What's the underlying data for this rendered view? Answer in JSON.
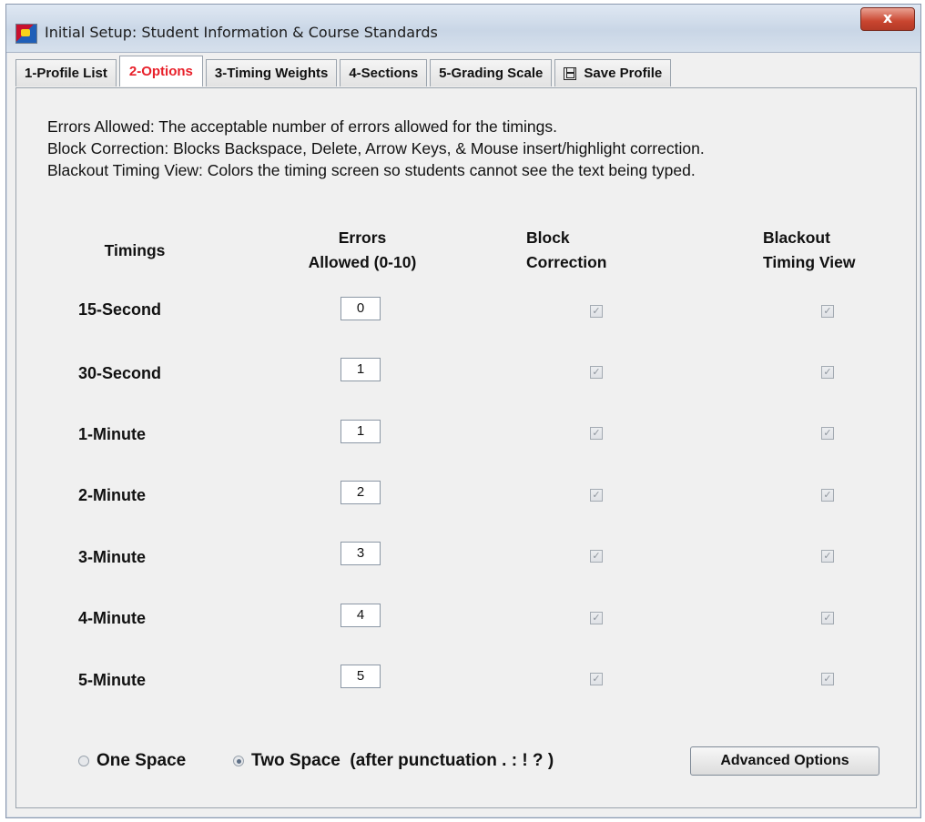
{
  "window": {
    "title": "Initial Setup: Student Information & Course Standards",
    "close_label": "x"
  },
  "tabs": [
    {
      "label": "1-Profile List",
      "active": false
    },
    {
      "label": "2-Options",
      "active": true
    },
    {
      "label": "3-Timing Weights",
      "active": false
    },
    {
      "label": "4-Sections",
      "active": false
    },
    {
      "label": "5-Grading Scale",
      "active": false
    },
    {
      "label": "Save Profile",
      "active": false,
      "icon": "save-icon"
    }
  ],
  "description": [
    "Errors Allowed: The acceptable number of errors allowed for the timings.",
    "Block Correction: Blocks Backspace, Delete, Arrow Keys, & Mouse insert/highlight correction.",
    "Blackout Timing View: Colors the timing screen so students cannot see the text being typed."
  ],
  "columns": {
    "timings": "Timings",
    "errors_line1": "Errors",
    "errors_line2": "Allowed (0-10)",
    "block_line1": "Block",
    "block_line2": "Correction",
    "blackout_line1": "Blackout",
    "blackout_line2": "Timing View"
  },
  "rows": [
    {
      "label": "15-Second",
      "errors": "0",
      "block_correction": true,
      "blackout": true
    },
    {
      "label": "30-Second",
      "errors": "1",
      "block_correction": true,
      "blackout": true
    },
    {
      "label": "1-Minute",
      "errors": "1",
      "block_correction": true,
      "blackout": true
    },
    {
      "label": "2-Minute",
      "errors": "2",
      "block_correction": true,
      "blackout": true
    },
    {
      "label": "3-Minute",
      "errors": "3",
      "block_correction": true,
      "blackout": true
    },
    {
      "label": "4-Minute",
      "errors": "4",
      "block_correction": true,
      "blackout": true
    },
    {
      "label": "5-Minute",
      "errors": "5",
      "block_correction": true,
      "blackout": true
    }
  ],
  "spacing": {
    "one_space_label": "One Space",
    "two_space_label": "Two Space  (after punctuation . : ! ? )",
    "selected": "two"
  },
  "advanced_button": "Advanced Options",
  "colors": {
    "active_tab": "#e8202a"
  }
}
